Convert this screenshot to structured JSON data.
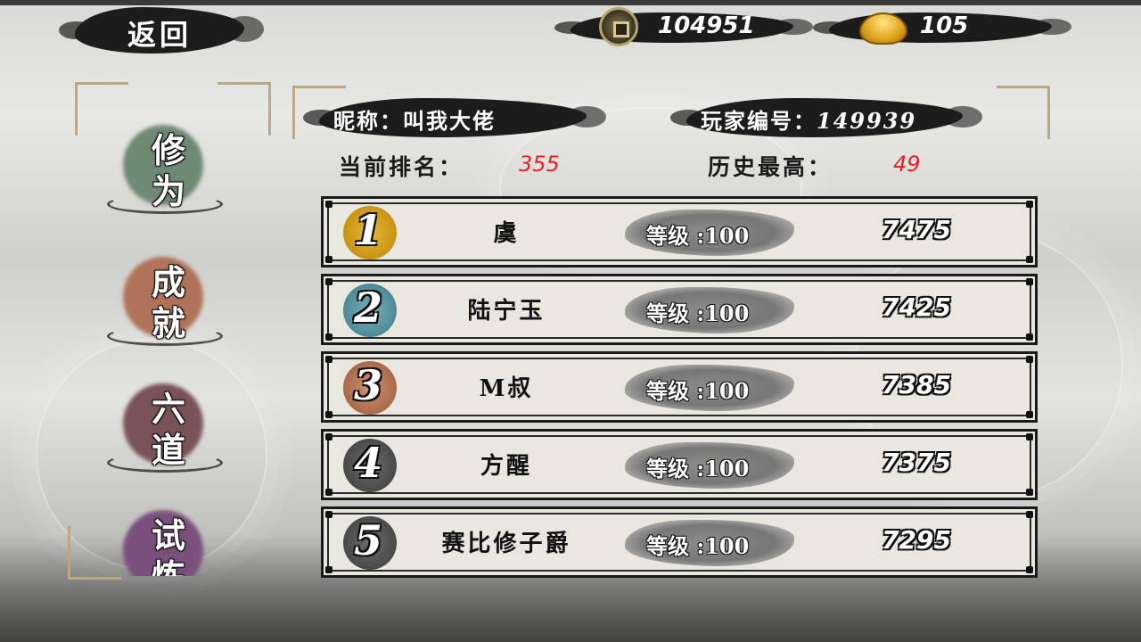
{
  "header": {
    "back_label": "返回",
    "coins": "104951",
    "ingots": "105"
  },
  "side_tabs": [
    {
      "label_top": "修",
      "label_bottom": "为",
      "color": "#6f8a73"
    },
    {
      "label_top": "成",
      "label_bottom": "就",
      "color": "#b0735a"
    },
    {
      "label_top": "六",
      "label_bottom": "道",
      "color": "#7a5358"
    },
    {
      "label_top": "试",
      "label_bottom": "炼",
      "color": "#7a4f7c"
    }
  ],
  "player": {
    "nickname_label": "昵称：",
    "nickname": "叫我大佬",
    "id_label": "玩家编号：",
    "id": "149939",
    "current_rank_label": "当前排名：",
    "current_rank": "355",
    "best_rank_label": "历史最高：",
    "best_rank": "49"
  },
  "rankings": [
    {
      "rank": "1",
      "name": "虞",
      "level": "等级 :100",
      "score": "7475",
      "badge_color": "#d8a72a"
    },
    {
      "rank": "2",
      "name": "陆宁玉",
      "level": "等级 :100",
      "score": "7425",
      "badge_color": "#5f9aa6"
    },
    {
      "rank": "3",
      "name": "M叔",
      "level": "等级 :100",
      "score": "7385",
      "badge_color": "#b9785a"
    },
    {
      "rank": "4",
      "name": "方醒",
      "level": "等级 :100",
      "score": "7375",
      "badge_color": "#555555"
    },
    {
      "rank": "5",
      "name": "赛比修子爵",
      "level": "等级 :100",
      "score": "7295",
      "badge_color": "#555555"
    }
  ]
}
